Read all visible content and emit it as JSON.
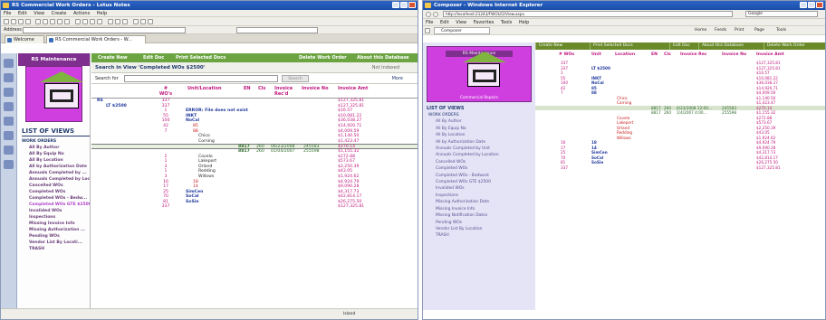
{
  "left": {
    "title": "RS Commercial Work Orders - Lotus Notes",
    "menu": [
      "File",
      "Edit",
      "View",
      "Create",
      "Actions",
      "Help"
    ],
    "address_label": "Address",
    "tabs": [
      {
        "label": "Welcome"
      },
      {
        "label": "RS Commercial Work Orders - W..."
      }
    ],
    "nav": {
      "header": "RS Maintenance",
      "list_title": "LIST OF VIEWS",
      "items": [
        {
          "label": "WORK ORDERS",
          "level": "top"
        },
        {
          "label": "All By Author"
        },
        {
          "label": "All By Equip No"
        },
        {
          "label": "All By Location"
        },
        {
          "label": "All by Authorization Date"
        },
        {
          "label": "Annuals Completed by ..."
        },
        {
          "label": "Annuals Completed by Loc"
        },
        {
          "label": "Cancelled WOs"
        },
        {
          "label": "Completed WOs"
        },
        {
          "label": "Completed WOs - Bedw..."
        },
        {
          "label": "Completed WOs GTE $2500",
          "highlight": true
        },
        {
          "label": "Invalided WOs"
        },
        {
          "label": "Inspections"
        },
        {
          "label": "Missing Invoice Info"
        },
        {
          "label": "Missing Authorization ..."
        },
        {
          "label": "Pending WOs"
        },
        {
          "label": "Vendor List By Locati..."
        },
        {
          "label": "TRASH"
        }
      ]
    },
    "actions": [
      "Create New",
      "Edit Doc",
      "Print Selected Docs",
      "Delete Work Order",
      "About this Database"
    ],
    "search_title": "Search in View 'Completed WOs $2500'",
    "not_indexed": "Not Indexed",
    "search_for_label": "Search for",
    "search_button": "Search",
    "more_label": "More",
    "columns": [
      "# WO's",
      "Unit/Location",
      "EN",
      "Cls",
      "Invoice Rec'd",
      "Invoice No",
      "Invoice Amt"
    ],
    "rows": [
      {
        "n": "337",
        "loc": "",
        "lvl": 0,
        "twisty": "RS",
        "amt": "$127,325.81"
      },
      {
        "n": "337",
        "loc": "",
        "lvl": 1,
        "twisty": "LT $2500",
        "amt": "$127,325.81"
      },
      {
        "n": "1",
        "loc": "ERROR: File does not exist",
        "lvl": 2,
        "kind": "err",
        "amt": "$16.57"
      },
      {
        "n": "55",
        "loc": "INKT",
        "lvl": 2,
        "kind": "blue",
        "amt": "$10,081.22"
      },
      {
        "n": "100",
        "loc": "NoCal",
        "lvl": 2,
        "kind": "blue",
        "amt": "$36,038.27"
      },
      {
        "n": "42",
        "loc": "85",
        "lvl": 3,
        "kind": "red",
        "amt": "$14,920.71"
      },
      {
        "n": "7",
        "loc": "88",
        "lvl": 3,
        "kind": "red",
        "amt": "$4,009.59"
      },
      {
        "n": "",
        "loc": "Chico",
        "lvl": 4,
        "amt": "$1,140.50"
      },
      {
        "n": "",
        "loc": "Corning",
        "lvl": 4,
        "amt": "$1,423.47"
      },
      {
        "n": "",
        "loc": "",
        "lvl": 4,
        "en": "8817",
        "cls": "260",
        "rec": "06/23/2008",
        "inv": "245583",
        "amt": "$270.14",
        "sel": true
      },
      {
        "n": "",
        "loc": "",
        "lvl": 4,
        "en": "8817",
        "cls": "260",
        "rec": "01/04/2007",
        "inv": "255598",
        "amt": "$1,155.32"
      },
      {
        "n": "2",
        "loc": "Covelo",
        "lvl": 4,
        "amt": "$272.88"
      },
      {
        "n": "1",
        "loc": "Lakeport",
        "lvl": 4,
        "amt": "$573.67"
      },
      {
        "n": "3",
        "loc": "Orland",
        "lvl": 4,
        "amt": "$2,250.39"
      },
      {
        "n": "1",
        "loc": "Redding",
        "lvl": 4,
        "amt": "$43.05"
      },
      {
        "n": "3",
        "loc": "Willows",
        "lvl": 4,
        "amt": "$1,924.62"
      },
      {
        "n": "16",
        "loc": "18",
        "lvl": 3,
        "kind": "red",
        "amt": "$4,924.79"
      },
      {
        "n": "17",
        "loc": "14",
        "lvl": 3,
        "kind": "red",
        "amt": "$9,090.28"
      },
      {
        "n": "25",
        "loc": "SimCen",
        "lvl": 2,
        "kind": "blue",
        "amt": "$4,317.73"
      },
      {
        "n": "70",
        "loc": "SoCal",
        "lvl": 2,
        "kind": "blue",
        "amt": "$42,814.17"
      },
      {
        "n": "81",
        "loc": "SoSie",
        "lvl": 2,
        "kind": "blue",
        "amt": "$26,275.50"
      },
      {
        "n": "337",
        "loc": "",
        "lvl": 1,
        "amt": "$127,325.81"
      }
    ],
    "status": [
      "Island"
    ]
  },
  "right": {
    "title": "Composer - Windows Internet Explorer",
    "url": "http://localhost:21243/FWOU/2/View.aspx",
    "search_placeholder": "Google",
    "menu": [
      "File",
      "Edit",
      "View",
      "Favorites",
      "Tools",
      "Help"
    ],
    "tab": "Composer",
    "toolbar_right": [
      "Home",
      "Feeds",
      "Print",
      "Page",
      "Tools"
    ],
    "actions": [
      "Create New",
      "Print Selected Docs",
      "Edit Doc",
      "About this Database",
      "Delete Work Order"
    ],
    "nav_header": "RS Maintenance",
    "logo_caption": "Commercial Repairs",
    "list_title": "LIST OF VIEWS",
    "nav_items": [
      {
        "label": "WORK ORDERS",
        "level": "top"
      },
      {
        "label": "All By Author"
      },
      {
        "label": "All By Equip No"
      },
      {
        "label": "All By Location"
      },
      {
        "label": "All by Authorization Date"
      },
      {
        "label": "Annuals Completed by Unit"
      },
      {
        "label": "Annuals Completed by Location"
      },
      {
        "label": "Cancelled WOs"
      },
      {
        "label": "Completed WOs"
      },
      {
        "label": "Completed WOs - Bedwork"
      },
      {
        "label": "Completed WOs GTE $2500"
      },
      {
        "label": "Invalided WOs"
      },
      {
        "label": "Inspections"
      },
      {
        "label": "Missing Authorization Date"
      },
      {
        "label": "Missing Invoice Info"
      },
      {
        "label": "Missing Notification Dates"
      },
      {
        "label": "Pending WOs"
      },
      {
        "label": "Vendor List By Location"
      },
      {
        "label": "TRASH"
      }
    ],
    "columns": [
      "# WOs",
      "Unit",
      "Location",
      "EN",
      "Cls",
      "Invoice Rec",
      "Invoice No",
      "Invoice Amt"
    ],
    "rows": [
      {
        "n": "337",
        "unit": "",
        "loc": "",
        "amt": "$127,325.81"
      },
      {
        "n": "337",
        "unit": "LT $2500",
        "loc": "",
        "amt": "$127,325.81"
      },
      {
        "n": "1",
        "unit": "",
        "loc": "",
        "amt": "$16.57"
      },
      {
        "n": "55",
        "unit": "INKT",
        "loc": "",
        "amt": "$10,081.22"
      },
      {
        "n": "100",
        "unit": "NoCal",
        "loc": "",
        "amt": "$36,038.27"
      },
      {
        "n": "42",
        "unit": "85",
        "loc": "",
        "amt": "$14,920.71"
      },
      {
        "n": "7",
        "unit": "88",
        "loc": "",
        "amt": "$4,009.59"
      },
      {
        "n": "",
        "unit": "",
        "loc": "Chico",
        "amt": "$1,140.50"
      },
      {
        "n": "",
        "unit": "",
        "loc": "Corning",
        "amt": "$1,423.47"
      },
      {
        "n": "",
        "unit": "",
        "loc": "",
        "en": "8817",
        "cls": "260",
        "rec": "6/23/2008 12:00...",
        "inv": "245583",
        "amt": "$270.14",
        "sel": true
      },
      {
        "n": "",
        "unit": "",
        "loc": "",
        "en": "8817",
        "cls": "260",
        "rec": "1/4/2007 4:00...",
        "inv": "255598",
        "amt": "$1,155.32"
      },
      {
        "n": "",
        "unit": "",
        "loc": "Covelo",
        "amt": "$272.88"
      },
      {
        "n": "",
        "unit": "",
        "loc": "Lakeport",
        "amt": "$573.67"
      },
      {
        "n": "",
        "unit": "",
        "loc": "Orland",
        "amt": "$2,250.39"
      },
      {
        "n": "",
        "unit": "",
        "loc": "Redding",
        "amt": "$43.05"
      },
      {
        "n": "",
        "unit": "",
        "loc": "Willows",
        "amt": "$1,924.62"
      },
      {
        "n": "16",
        "unit": "18",
        "loc": "",
        "amt": "$4,924.79"
      },
      {
        "n": "17",
        "unit": "14",
        "loc": "",
        "amt": "$9,090.28"
      },
      {
        "n": "25",
        "unit": "SimCen",
        "loc": "",
        "amt": "$4,317.73"
      },
      {
        "n": "70",
        "unit": "SoCal",
        "loc": "",
        "amt": "$42,814.17"
      },
      {
        "n": "81",
        "unit": "SoSie",
        "loc": "",
        "amt": "$26,275.50"
      },
      {
        "n": "337",
        "unit": "",
        "loc": "",
        "amt": "$127,325.81"
      }
    ]
  },
  "colors": {
    "accent_green": "#6ca441",
    "magenta": "#c0177d",
    "nav_purple": "#7f2f8e",
    "logo_pink": "#cf3fe0"
  }
}
